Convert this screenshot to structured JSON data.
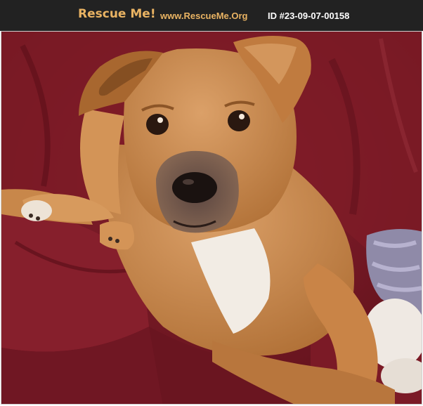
{
  "header": {
    "brand": "Rescue Me!",
    "site": "www.RescueMe.Org",
    "pet_id": "ID #23-09-07-00158"
  },
  "photo": {
    "subject": "puppy",
    "background_color": "#7a1a24",
    "fur_color": "#c98a4b"
  }
}
